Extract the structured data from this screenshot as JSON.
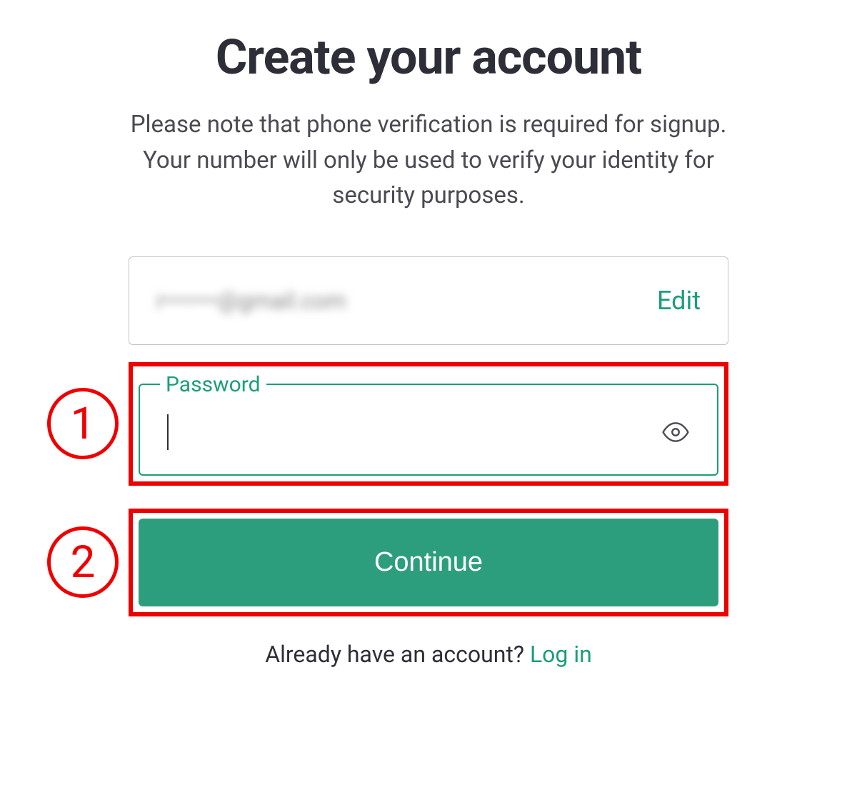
{
  "header": {
    "title": "Create your account",
    "subtitle": "Please note that phone verification is required for signup. Your number will only be used to verify your identity for security purposes."
  },
  "email_field": {
    "value": "r•••••••@gmail.com",
    "edit_label": "Edit"
  },
  "password_field": {
    "label": "Password",
    "value": ""
  },
  "continue_button": {
    "label": "Continue"
  },
  "footer": {
    "prompt": "Already have an account? ",
    "login_label": "Log in"
  },
  "annotations": {
    "badge_1": "1",
    "badge_2": "2"
  }
}
